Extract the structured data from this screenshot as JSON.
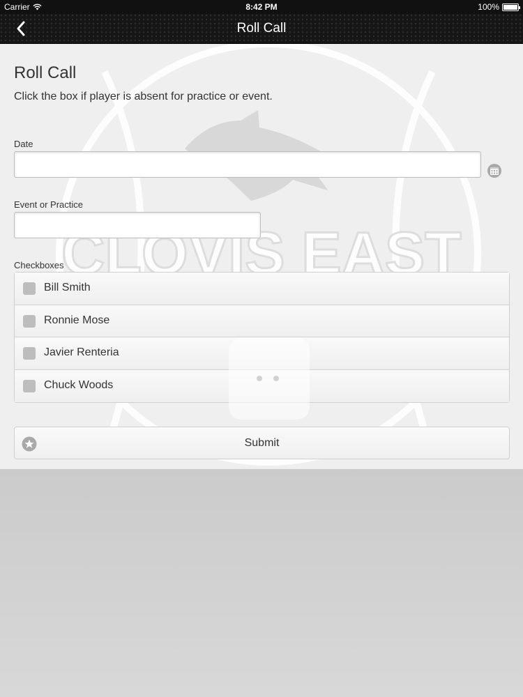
{
  "status_bar": {
    "carrier": "Carrier",
    "time": "8:42 PM",
    "battery": "100%"
  },
  "nav": {
    "title": "Roll Call",
    "back_icon": "chevron-left-icon"
  },
  "page": {
    "title": "Roll Call",
    "instructions": "Click the box if player is absent for practice or event."
  },
  "watermark": {
    "text": "CLOVIS EAST"
  },
  "form": {
    "date": {
      "label": "Date",
      "value": "",
      "calendar_icon": "calendar-icon"
    },
    "event": {
      "label": "Event or Practice",
      "value": ""
    },
    "checkboxes": {
      "label": "Checkboxes",
      "players": [
        {
          "name": "Bill Smith",
          "checked": false
        },
        {
          "name": "Ronnie Mose",
          "checked": false
        },
        {
          "name": "Javier Renteria",
          "checked": false
        },
        {
          "name": "Chuck Woods",
          "checked": false
        }
      ]
    },
    "submit": {
      "label": "Submit",
      "icon": "star-icon"
    }
  },
  "colors": {
    "nav_bg": "#161616",
    "content_bg": "#efefef",
    "checkbox": "#bdbdbd"
  }
}
